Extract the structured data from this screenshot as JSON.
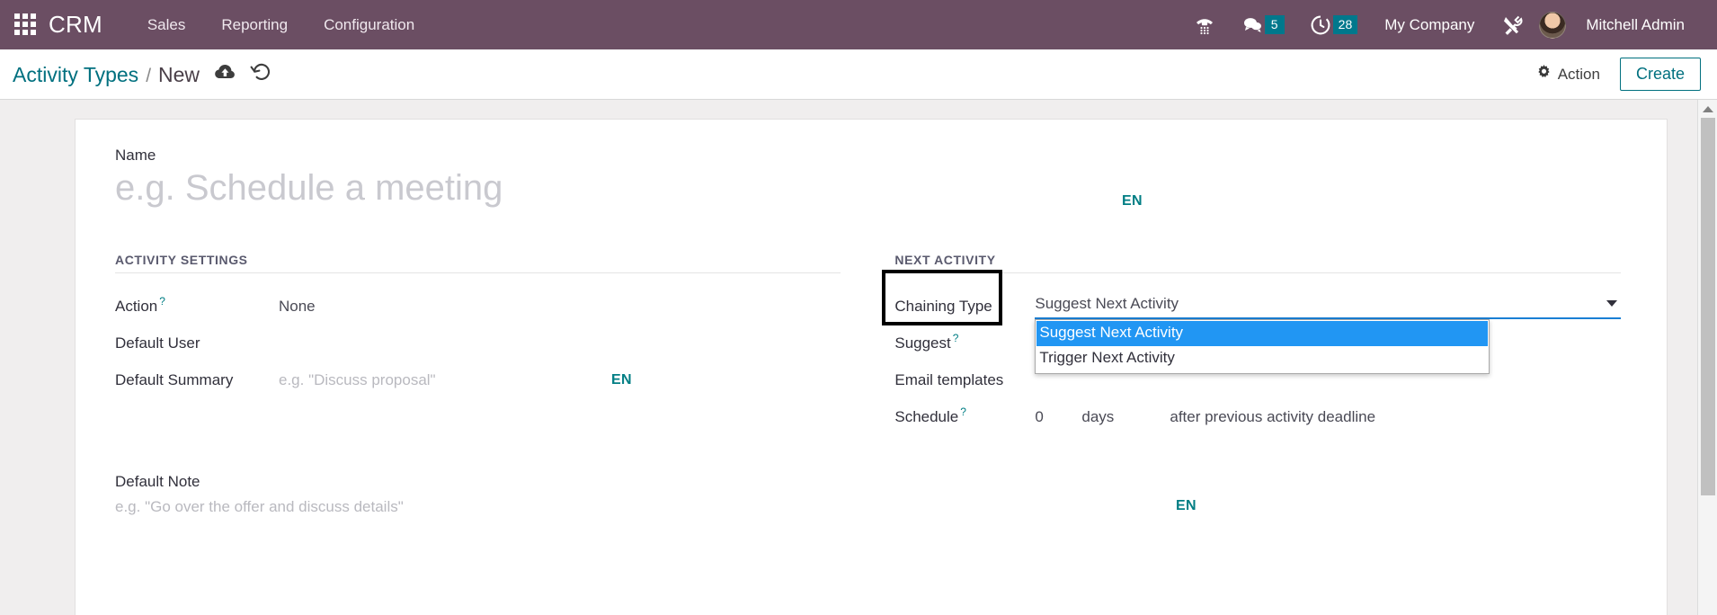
{
  "navbar": {
    "apps_icon": "apps-grid-icon",
    "brand": "CRM",
    "menu": [
      {
        "label": "Sales"
      },
      {
        "label": "Reporting"
      },
      {
        "label": "Configuration"
      }
    ],
    "phone_icon": "phone-dialpad-icon",
    "messages_icon": "chat-bubble-icon",
    "messages_count": "5",
    "activities_icon": "clock-icon",
    "activities_count": "28",
    "company": "My Company",
    "tools_icon": "tools-icon",
    "avatar_icon": "user-avatar",
    "user": "Mitchell Admin",
    "brand_color": "#6b4e63",
    "badge_color": "#00788c"
  },
  "control_panel": {
    "breadcrumb_root": "Activity Types",
    "breadcrumb_sep": "/",
    "breadcrumb_current": "New",
    "save_icon": "cloud-upload-icon",
    "discard_icon": "undo-icon",
    "action_icon": "gear-icon",
    "action_label": "Action",
    "create_label": "Create",
    "accent_color": "#00707f"
  },
  "form": {
    "name_label": "Name",
    "name_value": "",
    "name_placeholder": "e.g. Schedule a meeting",
    "name_lang_badge": "EN",
    "activity_settings": {
      "title": "ACTIVITY SETTINGS",
      "action_label": "Action",
      "action_help": "?",
      "action_value": "None",
      "default_user_label": "Default User",
      "default_user_value": "",
      "default_summary_label": "Default Summary",
      "default_summary_value": "",
      "default_summary_placeholder": "e.g. \"Discuss proposal\"",
      "default_summary_lang_badge": "EN"
    },
    "next_activity": {
      "title": "NEXT ACTIVITY",
      "chaining_type_label": "Chaining Type",
      "chaining_type_value": "Suggest Next Activity",
      "chaining_type_options": [
        "Suggest Next Activity",
        "Trigger Next Activity"
      ],
      "chaining_type_selected_index": 0,
      "dropdown_open": true,
      "highlight_color": "#000000",
      "selected_option_color": "#2196f3",
      "suggest_label": "Suggest",
      "suggest_help": "?",
      "suggest_value": "",
      "email_templates_label": "Email templates",
      "email_templates_value": "",
      "schedule_label": "Schedule",
      "schedule_help": "?",
      "schedule_days": "0",
      "schedule_unit": "days",
      "schedule_after": "after previous activity deadline"
    },
    "default_note_label": "Default Note",
    "default_note_value": "",
    "default_note_placeholder": "e.g. \"Go over the offer and discuss details\"",
    "default_note_lang_badge": "EN"
  },
  "scrollbar": {
    "up_arrow_icon": "triangle-up-icon"
  }
}
